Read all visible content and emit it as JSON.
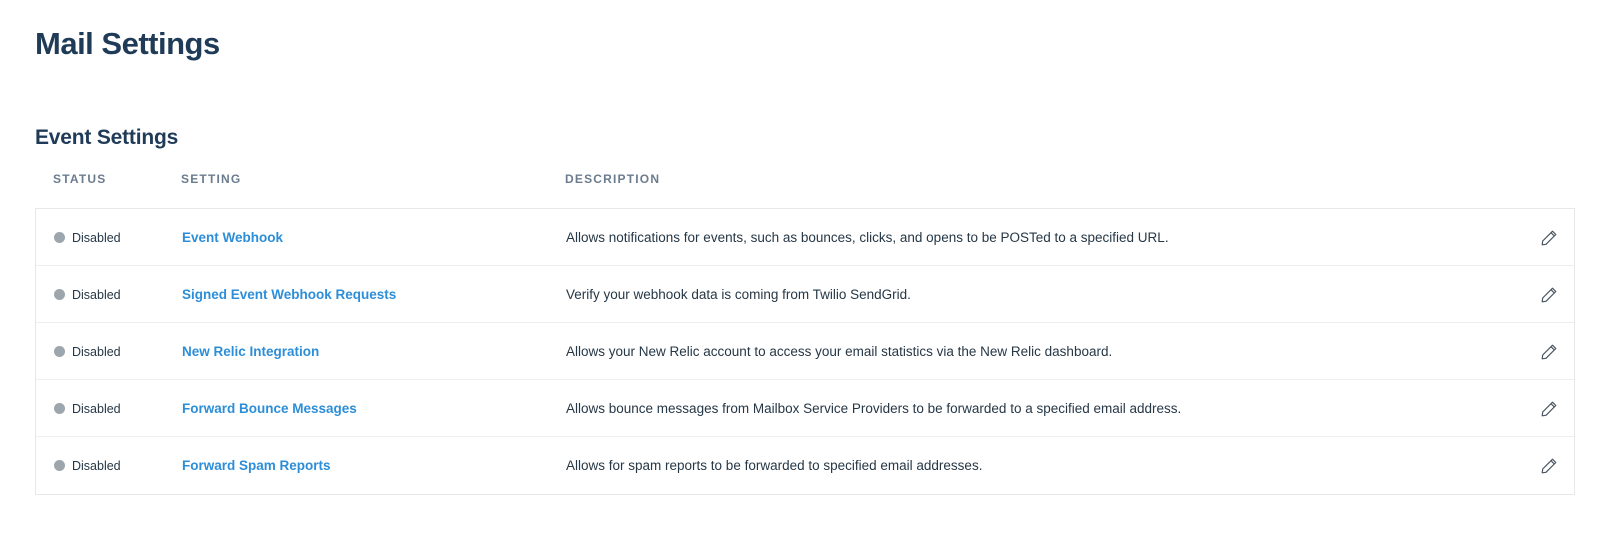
{
  "page": {
    "title": "Mail Settings"
  },
  "section": {
    "title": "Event Settings"
  },
  "table": {
    "headers": {
      "status": "STATUS",
      "setting": "SETTING",
      "description": "DESCRIPTION"
    },
    "rows": [
      {
        "status": "Disabled",
        "setting": "Event Webhook",
        "description": "Allows notifications for events, such as bounces, clicks, and opens to be POSTed to a specified URL."
      },
      {
        "status": "Disabled",
        "setting": "Signed Event Webhook Requests",
        "description": "Verify your webhook data is coming from Twilio SendGrid."
      },
      {
        "status": "Disabled",
        "setting": "New Relic Integration",
        "description": "Allows your New Relic account to access your email statistics via the New Relic dashboard."
      },
      {
        "status": "Disabled",
        "setting": "Forward Bounce Messages",
        "description": "Allows bounce messages from Mailbox Service Providers to be forwarded to a specified email address."
      },
      {
        "status": "Disabled",
        "setting": "Forward Spam Reports",
        "description": "Allows for spam reports to be forwarded to specified email addresses."
      }
    ]
  },
  "colors": {
    "title": "#1f3b57",
    "link": "#2c8ed8",
    "status_disabled": "#9da5ad",
    "header_text": "#6b7c8f"
  },
  "icons": {
    "edit": "pencil-icon",
    "status": "status-dot"
  }
}
